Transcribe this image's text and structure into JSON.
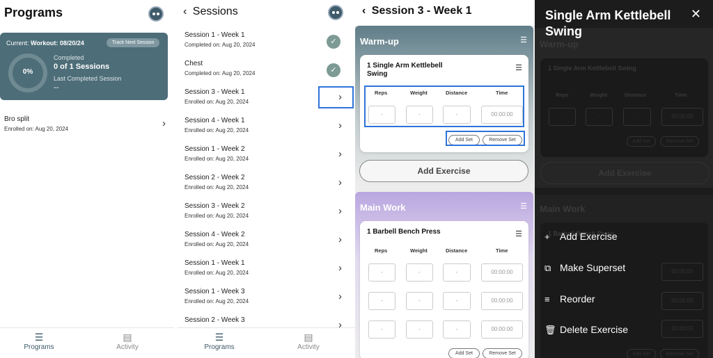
{
  "programs": {
    "title": "Programs",
    "current_label": "Current:",
    "current_value": "Workout: 08/20/24",
    "track_button": "Track Next Session",
    "progress_percent": "0%",
    "progress_fraction": 0,
    "completed_label": "Completed",
    "completed_value": "0 of 1 Sessions",
    "last_label": "Last Completed Session",
    "last_value": "--",
    "item_title": "Bro split",
    "item_sub": "Enrolled on: Aug 20, 2024"
  },
  "tabs": {
    "programs": "Programs",
    "activity": "Activity"
  },
  "sessions": {
    "title": "Sessions",
    "items": [
      {
        "title": "Session 1 - Week 1",
        "sub": "Completed on: Aug 20, 2024"
      },
      {
        "title": "Chest",
        "sub": "Completed on: Aug 20, 2024"
      },
      {
        "title": "Session 3 - Week 1",
        "sub": "Enrolled on: Aug 20, 2024"
      },
      {
        "title": "Session 4 - Week 1",
        "sub": "Enrolled on: Aug 20, 2024"
      },
      {
        "title": "Session 1 - Week 2",
        "sub": "Enrolled on: Aug 20, 2024"
      },
      {
        "title": "Session 2 - Week 2",
        "sub": "Enrolled on: Aug 20, 2024"
      },
      {
        "title": "Session 3 - Week 2",
        "sub": "Enrolled on: Aug 20, 2024"
      },
      {
        "title": "Session 4 - Week 2",
        "sub": "Enrolled on: Aug 20, 2024"
      },
      {
        "title": "Session 1 - Week 1",
        "sub": "Enrolled on: Aug 20, 2024"
      },
      {
        "title": "Session 1 - Week 3",
        "sub": "Enrolled on: Aug 20, 2024"
      },
      {
        "title": "Session 2 - Week 3",
        "sub": ""
      }
    ]
  },
  "session": {
    "title": "Session 3 - Week 1",
    "warmup_title": "Warm-up",
    "warmup_exercise": "1 Single Arm Kettlebell Swing",
    "main_title": "Main Work",
    "main_exercise": "1 Barbell Bench Press",
    "col_reps": "Reps",
    "col_weight": "Weight",
    "col_distance": "Distance",
    "col_time": "Time",
    "cell_empty": "-",
    "cell_time": "00:00:00",
    "add_set": "Add Set",
    "remove_set": "Remove Set",
    "add_exercise": "Add Exercise"
  },
  "sheet": {
    "title": "Single Arm Kettlebell Swing",
    "close": "✕",
    "actions": {
      "add": "Add Exercise",
      "superset": "Make Superset",
      "reorder": "Reorder",
      "delete": "Delete Exercise"
    }
  },
  "colors": {
    "card": "#4d6d78",
    "warmup": "#6f8790",
    "mainwork": "#b9a6df",
    "highlight": "#2e73d8",
    "check": "#7d9a95"
  }
}
